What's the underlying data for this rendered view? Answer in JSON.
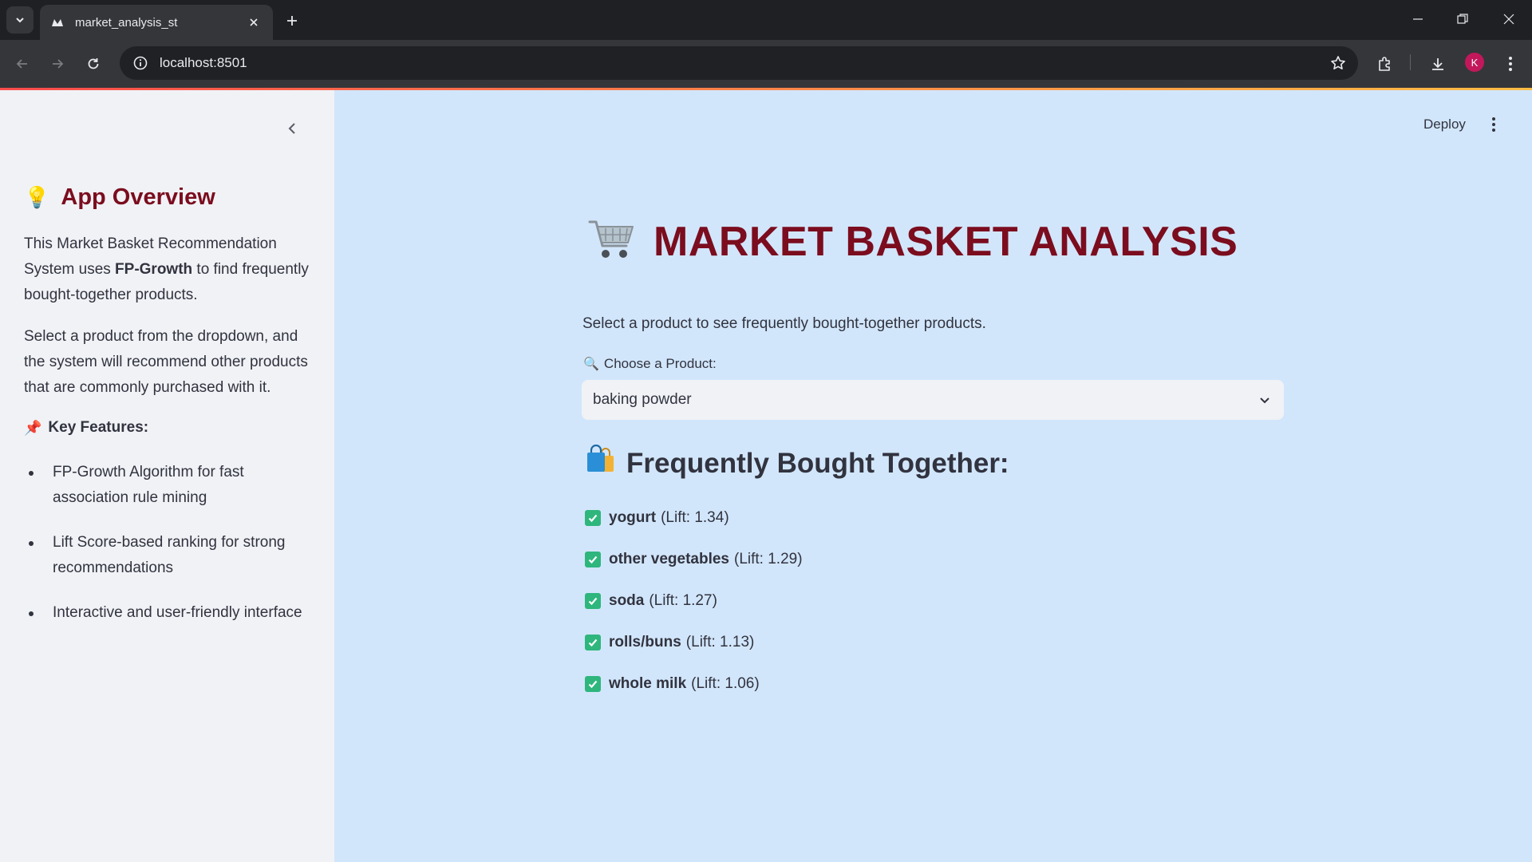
{
  "browser": {
    "tab_title": "market_analysis_st",
    "url": "localhost:8501",
    "profile_initial": "K"
  },
  "header": {
    "deploy_label": "Deploy"
  },
  "sidebar": {
    "heading_emoji": "💡",
    "heading": "App Overview",
    "intro_part1": "This Market Basket Recommendation System uses ",
    "intro_bold": "FP-Growth",
    "intro_part2": " to find frequently bought-together products.",
    "instructions": "Select a product from the dropdown, and the system will recommend other products that are commonly purchased with it.",
    "features_emoji": "📌",
    "features_heading": "Key Features:",
    "features": [
      "FP-Growth Algorithm for fast association rule mining",
      "Lift Score-based ranking for strong recommendations",
      "Interactive and user-friendly interface"
    ]
  },
  "main": {
    "title": "MARKET BASKET ANALYSIS",
    "subtitle": "Select a product to see frequently bought-together products.",
    "select_emoji": "🔍",
    "select_label": "Choose a Product:",
    "selected_product": "baking powder",
    "results_emoji": "🛍️",
    "results_heading": "Frequently Bought Together:",
    "recommendations": [
      {
        "name": "yogurt",
        "lift": "(Lift: 1.34)"
      },
      {
        "name": "other vegetables",
        "lift": "(Lift: 1.29)"
      },
      {
        "name": "soda",
        "lift": "(Lift: 1.27)"
      },
      {
        "name": "rolls/buns",
        "lift": "(Lift: 1.13)"
      },
      {
        "name": "whole milk",
        "lift": "(Lift: 1.06)"
      }
    ]
  },
  "colors": {
    "title": "#7b0d1e",
    "main_bg": "#d2e6fb",
    "sidebar_bg": "#f0f2f6",
    "check": "#2eb67d"
  }
}
